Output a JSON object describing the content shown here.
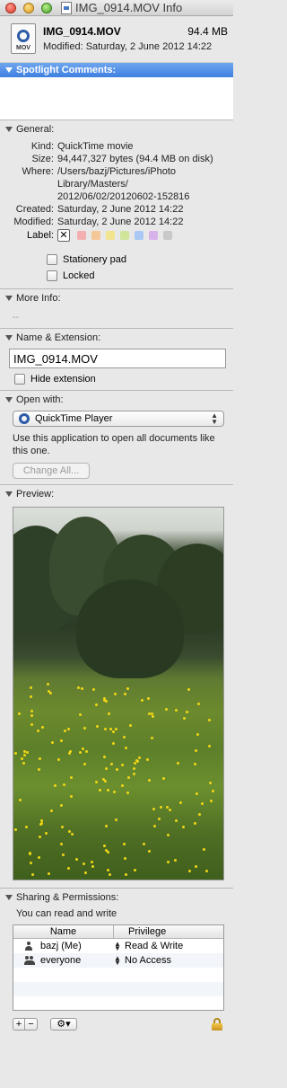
{
  "window": {
    "title": "IMG_0914.MOV Info"
  },
  "header": {
    "icon_ext": "MOV",
    "file_name": "IMG_0914.MOV",
    "size": "94.4 MB",
    "modified": "Modified: Saturday, 2 June 2012 14:22"
  },
  "spotlight": {
    "label": "Spotlight Comments:"
  },
  "general": {
    "label": "General:",
    "kind_label": "Kind:",
    "kind": "QuickTime movie",
    "size_label": "Size:",
    "size": "94,447,327 bytes (94.4 MB on disk)",
    "where_label": "Where:",
    "where": "/Users/bazj/Pictures/iPhoto Library/Masters/ 2012/06/02/20120602-152816",
    "created_label": "Created:",
    "created": "Saturday, 2 June 2012 14:22",
    "modified_label": "Modified:",
    "modified": "Saturday, 2 June 2012 14:22",
    "label_label": "Label:",
    "label_colors": [
      "#f4b0b0",
      "#f6c796",
      "#f3e48f",
      "#cfe59a",
      "#a9c8f3",
      "#d8b2ea",
      "#c9c9c9"
    ],
    "stationery_pad": "Stationery pad",
    "locked": "Locked"
  },
  "more_info": {
    "label": "More Info:",
    "value": "--"
  },
  "name_ext": {
    "label": "Name & Extension:",
    "value": "IMG_0914.MOV",
    "hide_extension": "Hide extension"
  },
  "open_with": {
    "label": "Open with:",
    "app": "QuickTime Player",
    "description": "Use this application to open all documents like this one.",
    "change_all": "Change All..."
  },
  "preview": {
    "label": "Preview:"
  },
  "sharing": {
    "label": "Sharing & Permissions:",
    "description": "You can read and write",
    "col_name": "Name",
    "col_privilege": "Privilege",
    "rows": [
      {
        "name": "bazj (Me)",
        "privilege": "Read & Write"
      },
      {
        "name": "everyone",
        "privilege": "No Access"
      }
    ],
    "add": "+",
    "remove": "−",
    "action": "⚙▾"
  }
}
